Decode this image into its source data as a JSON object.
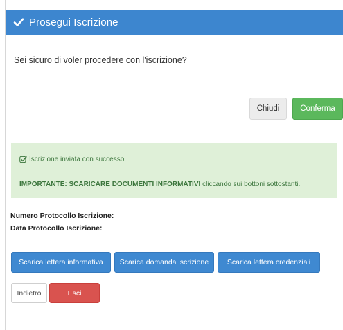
{
  "modal": {
    "title": "Prosegui Iscrizione",
    "question": "Sei sicuro di voler procedere con l'iscrizione?",
    "close_label": "Chiudi",
    "confirm_label": "Conferma"
  },
  "alert": {
    "success_text": "Iscrizione inviata con successo.",
    "important_strong": "IMPORTANTE: SCARICARE DOCUMENTI INFORMATIVI",
    "important_rest": " cliccando sui bottoni sottostanti."
  },
  "protocol": {
    "number_label": "Numero Protocollo Iscrizione:",
    "date_label": "Data Protocollo Iscrizione:"
  },
  "downloads": {
    "letter_label": "Scarica lettera informativa",
    "application_label": "Scarica domanda iscrizione",
    "credentials_label": "Scarica lettera credenziali"
  },
  "actions": {
    "back_label": "Indietro",
    "exit_label": "Esci"
  },
  "colors": {
    "header_blue": "#3d86cf",
    "success_green": "#5bb85c",
    "alert_bg": "#dff0d8",
    "alert_text": "#3c763d",
    "danger_red": "#d9534f"
  },
  "icons": {
    "header": "check-icon",
    "alert": "check-square-icon"
  }
}
